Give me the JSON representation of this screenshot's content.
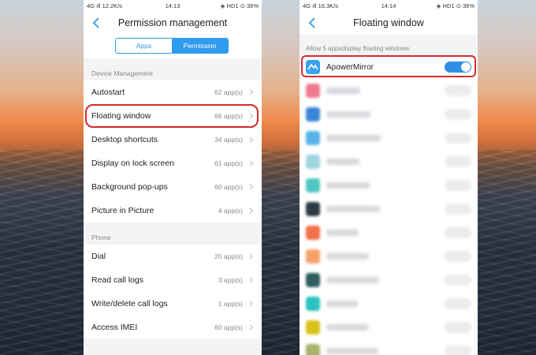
{
  "left_phone": {
    "status": {
      "left": "4G ıll 12.2K/s",
      "time": "14:13",
      "right": "◈ HD1 ⊙ 36%"
    },
    "title": "Permission management",
    "segment": {
      "apps": "Apps",
      "permission": "Permission",
      "selected": "Permission"
    },
    "sections": [
      {
        "header": "Device Management",
        "rows": [
          {
            "label": "Autostart",
            "count": "62 app(s)"
          },
          {
            "label": "Floating window",
            "count": "66 app(s)",
            "highlighted": true
          },
          {
            "label": "Desktop shortcuts",
            "count": "34 app(s)"
          },
          {
            "label": "Display on lock screen",
            "count": "61 app(s)"
          },
          {
            "label": "Background pop-ups",
            "count": "60 app(s)"
          },
          {
            "label": "Picture in Picture",
            "count": "4 app(s)"
          }
        ]
      },
      {
        "header": "Phone",
        "rows": [
          {
            "label": "Dial",
            "count": "20 app(s)"
          },
          {
            "label": "Read call logs",
            "count": "3 app(s)"
          },
          {
            "label": "Write/delete call logs",
            "count": "1 app(s)"
          },
          {
            "label": "Access IMEI",
            "count": "60 app(s)"
          }
        ]
      }
    ]
  },
  "right_phone": {
    "status": {
      "left": "4G ıll 16.3K/s",
      "time": "14:14",
      "right": "◈ HD1 ⊙ 36%"
    },
    "title": "Floating window",
    "allow_text": "Allow 5 appsdisplay floating windows",
    "apps": [
      {
        "name": "ApowerMirror",
        "enabled": true,
        "icon_color": "#3aa3f0",
        "icon": "apowermirror-icon"
      },
      {
        "name": "",
        "enabled": false,
        "icon_color": "#f07a90",
        "blurred": true
      },
      {
        "name": "",
        "enabled": false,
        "icon_color": "#3b86d8",
        "blurred": true
      },
      {
        "name": "",
        "enabled": false,
        "icon_color": "#58b4e8",
        "blurred": true
      },
      {
        "name": "",
        "enabled": false,
        "icon_color": "#9fd3e0",
        "blurred": true
      },
      {
        "name": "",
        "enabled": false,
        "icon_color": "#4fc7c0",
        "blurred": true
      },
      {
        "name": "",
        "enabled": false,
        "icon_color": "#2e3b44",
        "blurred": true
      },
      {
        "name": "",
        "enabled": false,
        "icon_color": "#f36f4a",
        "blurred": true
      },
      {
        "name": "",
        "enabled": false,
        "icon_color": "#f5a06a",
        "blurred": true
      },
      {
        "name": "",
        "enabled": false,
        "icon_color": "#2f5d5e",
        "blurred": true
      },
      {
        "name": "",
        "enabled": false,
        "icon_color": "#2bc2c2",
        "blurred": true
      },
      {
        "name": "",
        "enabled": false,
        "icon_color": "#d9c21a",
        "blurred": true
      },
      {
        "name": "",
        "enabled": false,
        "icon_color": "#a9b36a",
        "blurred": true
      }
    ]
  },
  "colors": {
    "accent": "#2f9cf0",
    "highlight": "#d62b2b"
  }
}
